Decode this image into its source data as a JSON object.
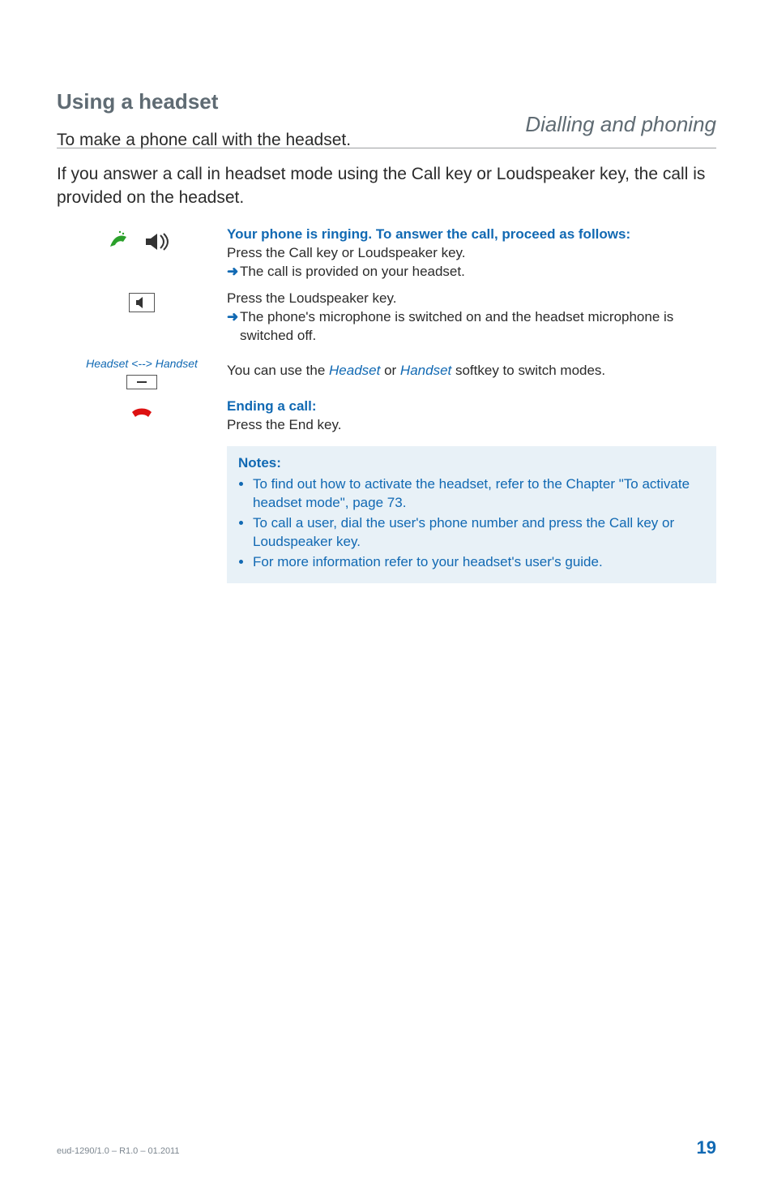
{
  "running_head": "Dialling and phoning",
  "section_title": "Using a headset",
  "intro_p1": "To make a phone call with the headset.",
  "intro_p2": "If you answer a call in headset mode using the Call key or Loudspeaker key, the call is provided on the headset.",
  "step1_heading": "Your phone is ringing. To answer the call, proceed as follows:",
  "step1_line1": "Press the Call key or Loudspeaker key.",
  "step1_result": "The call is provided on your headset.",
  "step2_line": "Press the Loudspeaker key.",
  "step2_result_a": "The phone's microphone is switched on and the headset microphone is",
  "step2_result_b": "switched off.",
  "mode_label": "Headset <--> Handset",
  "mode_line_a": "You can use the ",
  "mode_line_headset": "Headset",
  "mode_line_or": " or ",
  "mode_line_handset": "Handset",
  "mode_line_b": " softkey to switch modes.",
  "end_heading": "Ending a call:",
  "end_line": "Press the End key.",
  "notes_title": "Notes:",
  "note1_a": "To find out how to activate the headset, refer to the Chapter ",
  "note1_link": "\"To activate headset mode\"",
  "note1_b": ", page ",
  "note1_page": "73",
  "note1_c": ".",
  "note2": "To call a user, dial the user's phone number and press the Call key or Loudspeaker key.",
  "note3": "For more information refer to your headset's user's guide.",
  "footer_left": "eud-1290/1.0 – R1.0 – 01.2011",
  "footer_right": "19"
}
